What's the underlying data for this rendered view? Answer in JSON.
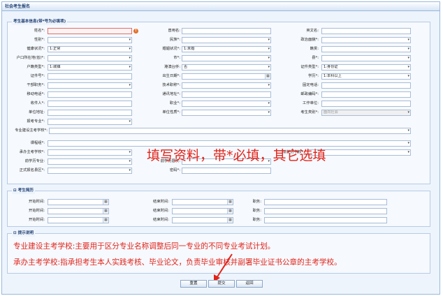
{
  "window_title": "社会考生报名",
  "basic": {
    "legend": "考生基本信息(带*号为必填项)",
    "fields": [
      {
        "label": "姓名*:",
        "value": "",
        "kind": "text",
        "error": true
      },
      {
        "label": "曾用名:",
        "value": "",
        "kind": "text"
      },
      {
        "label": "英文名:",
        "value": "",
        "kind": "text"
      },
      {
        "label": "性别*:",
        "value": "",
        "kind": "select"
      },
      {
        "label": "民族*:",
        "value": "",
        "kind": "select"
      },
      {
        "label": "政治面貌*:",
        "value": "",
        "kind": "select"
      },
      {
        "label": "健康状况*:",
        "value": "1:正常",
        "kind": "select"
      },
      {
        "label": "婚姻状况*:",
        "value": "1:未婚",
        "kind": "select"
      },
      {
        "label": "籍贯:",
        "value": "",
        "kind": "select"
      },
      {
        "label": "户口所在地(省)*:",
        "value": "",
        "kind": "select"
      },
      {
        "label": "市*:",
        "value": "",
        "kind": "select"
      },
      {
        "label": "县*:",
        "value": "",
        "kind": "select"
      },
      {
        "label": "户籍类型*:",
        "value": "1:城镇",
        "kind": "select"
      },
      {
        "label": "港澳台侨:",
        "value": "否",
        "kind": "select"
      },
      {
        "label": "证件类型*:",
        "value": "1:身份证",
        "kind": "select"
      },
      {
        "label": "证件号*:",
        "value": "",
        "kind": "text"
      },
      {
        "label": "出生日期*:",
        "value": "",
        "kind": "date"
      },
      {
        "label": "学历*:",
        "value": "1:本科以上",
        "kind": "select"
      },
      {
        "label": "干部职务*:",
        "value": "",
        "kind": "select"
      },
      {
        "label": "技术职称*:",
        "value": "",
        "kind": "select"
      },
      {
        "label": "固定电话:",
        "value": "",
        "kind": "text"
      },
      {
        "label": "移动电话*:",
        "value": "",
        "kind": "text"
      },
      {
        "label": "通讯地址*:",
        "value": "",
        "kind": "text"
      },
      {
        "label": "邮政编码*:",
        "value": "",
        "kind": "text"
      },
      {
        "label": "收件人*:",
        "value": "",
        "kind": "text"
      },
      {
        "label": "职业*:",
        "value": "",
        "kind": "select"
      },
      {
        "label": "工作单位:",
        "value": "",
        "kind": "text"
      },
      {
        "label": "单位地址:",
        "value": "",
        "kind": "text"
      },
      {
        "label": "单位性质*:",
        "value": "",
        "kind": "select"
      },
      {
        "label": "考生类别*:",
        "value": "面向社会",
        "kind": "select",
        "disabled": true
      },
      {
        "label": "报考专业*:",
        "value": "",
        "kind": "select"
      },
      {
        "label": "专业建设主考学校*:",
        "value": "",
        "kind": "select"
      },
      {
        "label": "课程组*:",
        "value": "",
        "kind": "select"
      },
      {
        "label": "承办主考学校*:",
        "value": "",
        "kind": "select"
      },
      {
        "label": "前学历学校*:",
        "value": "",
        "kind": "select"
      },
      {
        "label": "前学历专业:",
        "value": "",
        "kind": "select"
      },
      {
        "label": "前学历层次:",
        "value": "",
        "kind": "select"
      },
      {
        "label": "正式报名县区*:",
        "value": "",
        "kind": "select"
      },
      {
        "label": "密码*:",
        "value": "",
        "kind": "text"
      }
    ]
  },
  "resume": {
    "legend": "考生简历",
    "rows": [
      {
        "start": "开始时间:",
        "end": "结束时间:",
        "job": "职务:"
      },
      {
        "start": "开始时间:",
        "end": "结束时间:",
        "job": "职务:"
      },
      {
        "start": "开始时间:",
        "end": "结束时间:",
        "job": "职务:"
      }
    ]
  },
  "tips": {
    "legend": "提示说明",
    "line1": "专业建设主考学校:主要用于区分专业名称调整后同一专业的不同专业考试计划。",
    "line2": "承办主考学校:指承担考生本人实践考核、毕业论文，负责毕业审核并副署毕业证书公章的主考学校。"
  },
  "annotation": "填写资料，带*必填，其它选填",
  "buttons": {
    "reset": "重置",
    "submit": "提交",
    "back": "返回"
  },
  "colors": {
    "annotation": "#e2231a",
    "border": "#9ab8dc",
    "panel": "#eef4fc"
  }
}
